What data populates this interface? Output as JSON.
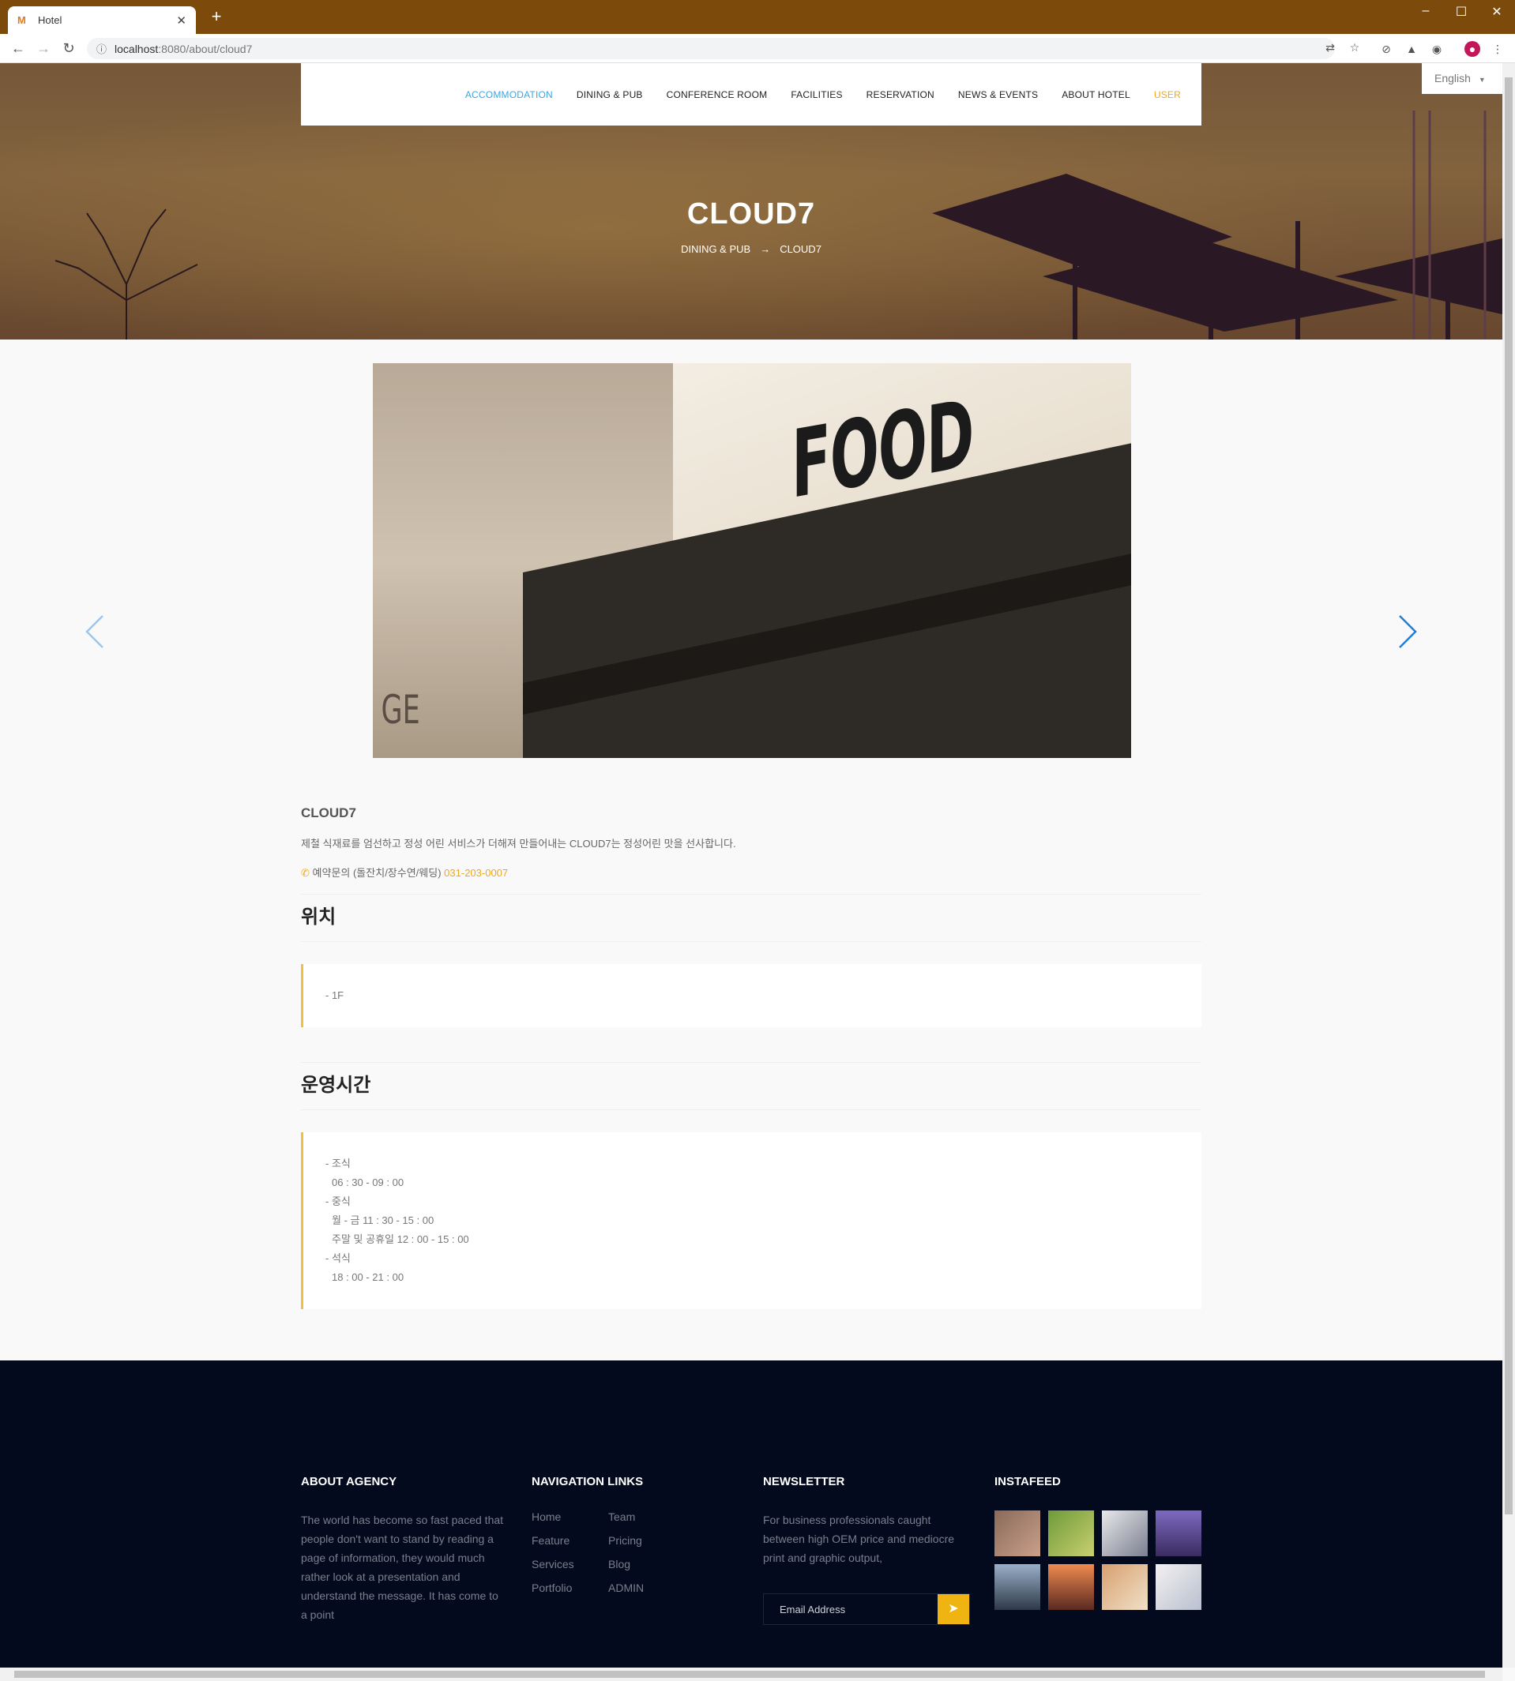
{
  "browser": {
    "tab_title": "Hotel",
    "url_host": "localhost",
    "url_rest": ":8080/about/cloud7"
  },
  "nav": {
    "items": [
      "ACCOMMODATION",
      "DINING & PUB",
      "CONFERENCE ROOM",
      "FACILITIES",
      "RESERVATION",
      "NEWS & EVENTS",
      "ABOUT HOTEL",
      "USER"
    ],
    "language": "English"
  },
  "hero": {
    "title": "CLOUD7",
    "crumb_parent": "DINING & PUB",
    "crumb_arrow": "→",
    "crumb_current": "CLOUD7"
  },
  "slider": {
    "sign_text": "FOOD",
    "partial_text": "GE"
  },
  "detail": {
    "name": "CLOUD7",
    "description": "제철 식재료를 엄선하고 정성 어린 서비스가 더해져 만들어내는 CLOUD7는 정성어린 맛을 선사합니다.",
    "phone_label": "예약문의 (돌잔치/장수연/웨딩)",
    "phone_number": "031-203-0007"
  },
  "location": {
    "title": "위치",
    "lines": [
      "- 1F"
    ]
  },
  "hours": {
    "title": "운영시간",
    "lines": [
      "- 조식",
      "06 : 30 - 09 : 00",
      "- 중식",
      "월 - 금 11 : 30 - 15 : 00",
      "주말 및 공휴일 12 : 00 - 15 : 00",
      "- 석식",
      "18 : 00 - 21 : 00"
    ]
  },
  "footer": {
    "about_title": "ABOUT AGENCY",
    "about_text": "The world has become so fast paced that people don't want to stand by reading a page of information, they would much rather look at a presentation and understand the message. It has come to a point",
    "nav_title": "NAVIGATION LINKS",
    "nav_links": [
      "Home",
      "Team",
      "Feature",
      "Pricing",
      "Services",
      "Blog",
      "Portfolio",
      "ADMIN"
    ],
    "newsletter_title": "NEWSLETTER",
    "newsletter_text": "For business professionals caught between high OEM price and mediocre print and graphic output,",
    "email_placeholder": "Email Address",
    "insta_title": "INSTAFEED"
  },
  "colors": {
    "accent": "#f0a81a",
    "nav_active": "#3aa6e0",
    "footer_bg": "#040a1d",
    "title_bar": "#7c4a0a"
  }
}
